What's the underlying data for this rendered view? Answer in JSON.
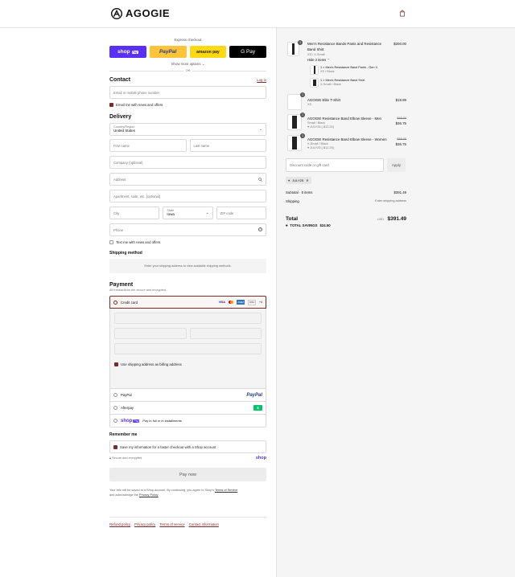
{
  "header": {
    "brand": "AGOGIE",
    "cart_icon": "shopping-bag-icon"
  },
  "express": {
    "title": "Express checkout",
    "buttons": [
      "shop",
      "PayPal",
      "amazon pay",
      "G Pay"
    ],
    "shop_badge": "Pay",
    "more": "Show more options",
    "or": "OR"
  },
  "contact": {
    "title": "Contact",
    "login": "Log in",
    "email_placeholder": "Email or mobile phone number",
    "news": "Email me with news and offers"
  },
  "delivery": {
    "title": "Delivery",
    "country_label": "Country/Region",
    "country_value": "United States",
    "first_name": "First name",
    "last_name": "Last name",
    "company": "Company (optional)",
    "address": "Address",
    "apartment": "Apartment, suite, etc. (optional)",
    "city": "City",
    "state_label": "State",
    "state_value": "Iowa",
    "zip": "ZIP code",
    "phone": "Phone",
    "text_news": "Text me with news and offers"
  },
  "shipping": {
    "title": "Shipping method",
    "message": "Enter your shipping address to view available shipping methods."
  },
  "payment": {
    "title": "Payment",
    "subtitle": "All transactions are secure and encrypted.",
    "credit_card": "Credit card",
    "card_brands": [
      "VISA",
      "MC",
      "AMEX",
      "DISC"
    ],
    "more_cards": "+4",
    "billing": "Use shipping address as billing address",
    "paypal": "PayPal",
    "paypal_logo": "PayPal",
    "afterpay": "Afterpay",
    "afterpay_logo": "$",
    "shop_pay_logo": "shop",
    "shop_pay_badge": "Pay",
    "shop_pay_text": "Pay in full or in installments"
  },
  "remember": {
    "title": "Remember me",
    "save": "Save my information for a faster checkout with a Shop account",
    "secure": "Secure and encrypted",
    "shop": "shop"
  },
  "pay_now": "Pay now",
  "disclaimer": {
    "text": "Your info will be saved to a Shop account. By continuing, you agree to Shop's",
    "terms": "Terms of Service",
    "and": "and acknowledge the",
    "privacy": "Privacy Policy"
  },
  "footer": [
    "Refund policy",
    "Privacy policy",
    "Terms of service",
    "Contact information"
  ],
  "cart": {
    "items": [
      {
        "qty": "1",
        "name": "Men's Resistance Bands Pants and Resistance Band Shirt",
        "variant": "XS / X-Small",
        "price": "$200.00",
        "hide": "Hide 2 items",
        "sub": [
          {
            "name": "1 × Men's Resistance Band Pants - Gen 3",
            "variant": "XS / Black"
          },
          {
            "name": "1 × Men's Resistance Band Shirt",
            "variant": "X-Small / Black"
          }
        ]
      },
      {
        "qty": "1",
        "name": "AGOGIE Elite T-Shirt",
        "variant": "XS",
        "price": "$19.99"
      },
      {
        "qty": "1",
        "name": "AGOGIE Resistance Band Elbow Sleeve - Men",
        "variant": "Small / Black",
        "discount": "JULY25 (-$12.25)",
        "old": "$49.00",
        "price": "$36.75"
      },
      {
        "qty": "1",
        "name": "AGOGIE Resistance Band Elbow Sleeve - Women",
        "variant": "X-Small / Black",
        "discount": "JULY25 (-$12.25)",
        "old": "$49.00",
        "price": "$36.75"
      }
    ],
    "discount_placeholder": "Discount code or gift card",
    "apply": "Apply",
    "code": "JULY25",
    "subtotal_label": "Subtotal · 5 items",
    "subtotal": "$391.49",
    "shipping_label": "Shipping",
    "shipping_value": "Enter shipping address",
    "total_label": "Total",
    "currency": "USD",
    "total": "$391.49",
    "savings_label": "TOTAL SAVINGS",
    "savings": "$24.50"
  },
  "colors": {
    "accent": "#7a2b2b",
    "shop": "#5a31f4",
    "paypal": "#ffc439",
    "amazon": "#ffd814",
    "afterpay": "#b2fce4"
  }
}
